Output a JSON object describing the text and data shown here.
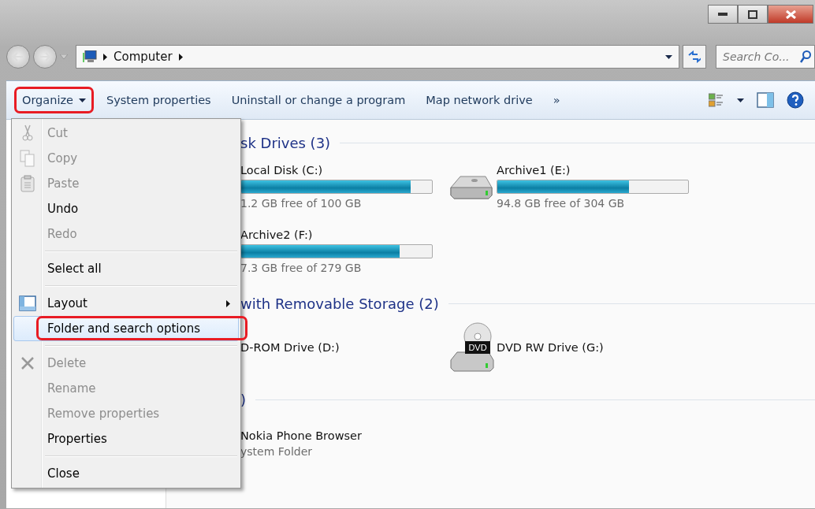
{
  "address": {
    "location": "Computer"
  },
  "search": {
    "placeholder": "Search Co..."
  },
  "toolbar": {
    "items": [
      {
        "label": "Organize",
        "dropdown": true,
        "highlighted": true
      },
      {
        "label": "System properties",
        "dropdown": false,
        "highlighted": false
      },
      {
        "label": "Uninstall or change a program",
        "dropdown": false,
        "highlighted": false
      },
      {
        "label": "Map network drive",
        "dropdown": false,
        "highlighted": false
      },
      {
        "label": "»",
        "dropdown": false,
        "highlighted": false
      }
    ]
  },
  "sections": [
    {
      "heading": "sk Drives (3)",
      "items": [
        {
          "kind": "disk",
          "name": "Local Disk (C:)",
          "level": 0.888,
          "detail": "1.2 GB free of 100 GB"
        },
        {
          "kind": "disk",
          "name": "Archive1 (E:)",
          "level": 0.69,
          "detail": "94.8 GB free of 304 GB"
        },
        {
          "kind": "disk",
          "name": "Archive2 (F:)",
          "level": 0.83,
          "detail": "7.3 GB free of 279 GB"
        }
      ]
    },
    {
      "heading": "with Removable Storage (2)",
      "items": [
        {
          "kind": "optical",
          "name": "D-ROM Drive (D:)"
        },
        {
          "kind": "optical",
          "name": "DVD RW Drive (G:)",
          "icon_label": "DVD"
        }
      ]
    },
    {
      "heading": ")",
      "items": [
        {
          "kind": "folder",
          "name": "Nokia Phone Browser",
          "detail": "ystem Folder"
        }
      ]
    }
  ],
  "menu": {
    "items": [
      {
        "kind": "item",
        "label": "Cut",
        "disabled": true,
        "selected": false,
        "highlighted": false,
        "submenu": false
      },
      {
        "kind": "item",
        "label": "Copy",
        "disabled": true,
        "selected": false,
        "highlighted": false,
        "submenu": false
      },
      {
        "kind": "item",
        "label": "Paste",
        "disabled": true,
        "selected": false,
        "highlighted": false,
        "submenu": false
      },
      {
        "kind": "item",
        "label": "Undo",
        "disabled": false,
        "selected": false,
        "highlighted": false,
        "submenu": false
      },
      {
        "kind": "item",
        "label": "Redo",
        "disabled": true,
        "selected": false,
        "highlighted": false,
        "submenu": false
      },
      {
        "kind": "separator"
      },
      {
        "kind": "item",
        "label": "Select all",
        "disabled": false,
        "selected": false,
        "highlighted": false,
        "submenu": false
      },
      {
        "kind": "separator"
      },
      {
        "kind": "item",
        "label": "Layout",
        "disabled": false,
        "selected": false,
        "highlighted": false,
        "submenu": true
      },
      {
        "kind": "item",
        "label": "Folder and search options",
        "disabled": false,
        "selected": true,
        "highlighted": true,
        "submenu": false
      },
      {
        "kind": "separator"
      },
      {
        "kind": "item",
        "label": "Delete",
        "disabled": true,
        "selected": false,
        "highlighted": false,
        "submenu": false
      },
      {
        "kind": "item",
        "label": "Rename",
        "disabled": true,
        "selected": false,
        "highlighted": false,
        "submenu": false
      },
      {
        "kind": "item",
        "label": "Remove properties",
        "disabled": true,
        "selected": false,
        "highlighted": false,
        "submenu": false
      },
      {
        "kind": "item",
        "label": "Properties",
        "disabled": false,
        "selected": false,
        "highlighted": false,
        "submenu": false
      },
      {
        "kind": "separator"
      },
      {
        "kind": "item",
        "label": "Close",
        "disabled": false,
        "selected": false,
        "highlighted": false,
        "submenu": false
      }
    ]
  }
}
